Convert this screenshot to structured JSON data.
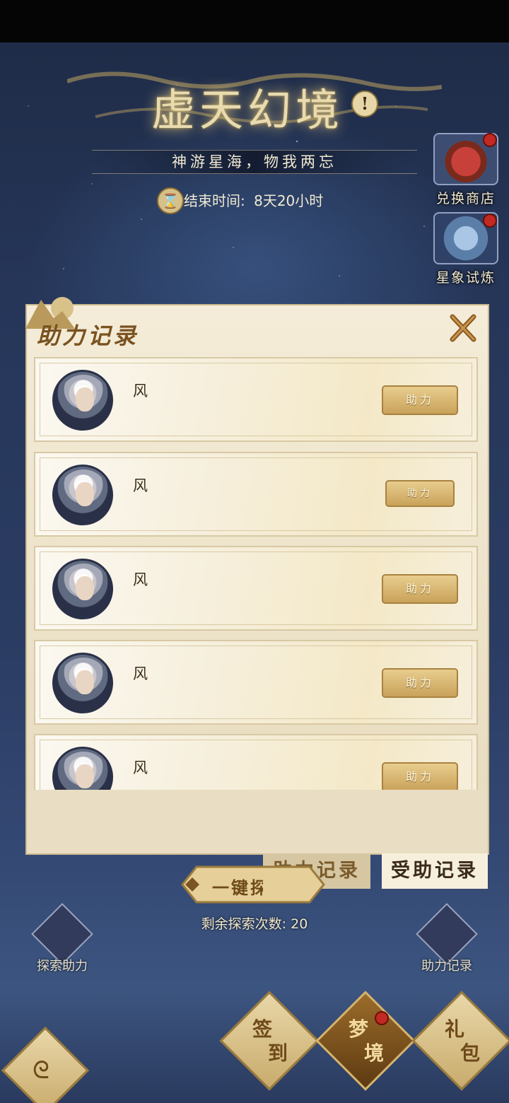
{
  "header": {
    "title": "虚天幻境",
    "subtitle": "神游星海，物我两忘",
    "timer_label": "结束时间:",
    "timer_value": "8天20小时"
  },
  "side_buttons": [
    {
      "label": "兑换商店",
      "icon": "treasure-chest-icon",
      "has_red_dot": true
    },
    {
      "label": "星象试炼",
      "icon": "star-tower-icon",
      "has_red_dot": true
    }
  ],
  "dialog": {
    "title": "助力记录",
    "rows": [
      {
        "name": "风",
        "button": "助力"
      },
      {
        "name": "风",
        "button": "助力"
      },
      {
        "name": "风",
        "button": "助力"
      },
      {
        "name": "风",
        "button": "助力"
      },
      {
        "name": "风",
        "button": "助力"
      }
    ],
    "tabs": [
      {
        "label": "助力记录",
        "active": false
      },
      {
        "label": "受助记录",
        "active": true
      }
    ]
  },
  "explore": {
    "button_label": "一键探索",
    "remaining_label": "剩余探索次数:",
    "remaining_value": "20"
  },
  "bottom_left": {
    "label": "探索助力",
    "icon": "fist-icon"
  },
  "bottom_right": {
    "label": "助力记录",
    "icon": "book-icon"
  },
  "nav": [
    {
      "top": "签",
      "bottom": "到",
      "active": false
    },
    {
      "top": "梦",
      "bottom": "境",
      "active": true,
      "has_red_dot": true
    },
    {
      "top": "礼",
      "bottom": "包",
      "active": false
    }
  ],
  "colors": {
    "gold": "#c9a25a",
    "panel": "#ece1c6",
    "night": "#263659",
    "red_dot": "#c02a22"
  }
}
